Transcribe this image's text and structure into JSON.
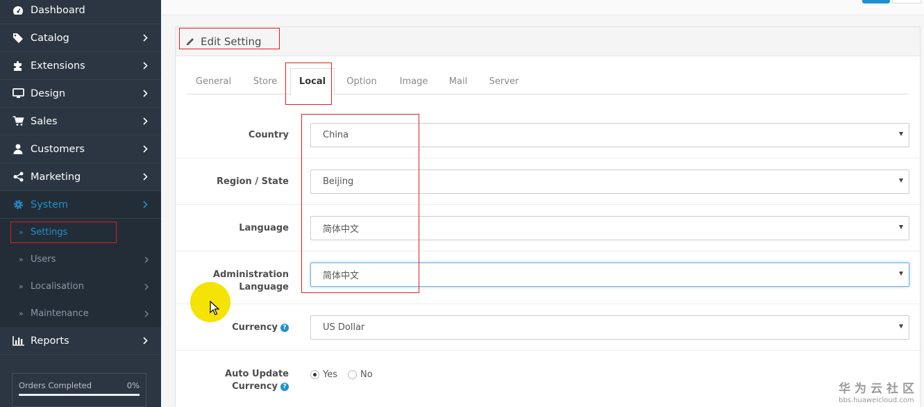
{
  "sidebar": {
    "items": [
      {
        "label": "Dashboard",
        "icon": "dashboard-icon"
      },
      {
        "label": "Catalog",
        "icon": "tags-icon"
      },
      {
        "label": "Extensions",
        "icon": "puzzle-icon"
      },
      {
        "label": "Design",
        "icon": "desktop-icon"
      },
      {
        "label": "Sales",
        "icon": "cart-icon"
      },
      {
        "label": "Customers",
        "icon": "user-icon"
      },
      {
        "label": "Marketing",
        "icon": "share-icon"
      },
      {
        "label": "System",
        "icon": "gear-icon"
      },
      {
        "label": "Reports",
        "icon": "bar-chart-icon"
      }
    ],
    "system_sub": [
      {
        "label": "Settings"
      },
      {
        "label": "Users"
      },
      {
        "label": "Localisation"
      },
      {
        "label": "Maintenance"
      }
    ],
    "progress": {
      "label": "Orders Completed",
      "value": "0%"
    }
  },
  "panel": {
    "title": "Edit Setting",
    "tabs": [
      "General",
      "Store",
      "Local",
      "Option",
      "Image",
      "Mail",
      "Server"
    ],
    "fields": {
      "country": {
        "label": "Country",
        "value": "China"
      },
      "region": {
        "label": "Region / State",
        "value": "Beijing"
      },
      "language": {
        "label": "Language",
        "value": "简体中文"
      },
      "admin_language": {
        "label_1": "Administration",
        "label_2": "Language",
        "value": "简体中文"
      },
      "currency": {
        "label": "Currency",
        "value": "US Dollar"
      },
      "auto_update": {
        "label_1": "Auto Update",
        "label_2": "Currency",
        "yes": "Yes",
        "no": "No"
      }
    }
  },
  "watermark": {
    "cn": "华为云社区",
    "en": "bbs.huaweicloud.com"
  },
  "colors": {
    "sidebar_bg": "#2b3642",
    "accent": "#1e91cf",
    "annotation": "#e31b1b",
    "cursor": "#f4e304"
  }
}
